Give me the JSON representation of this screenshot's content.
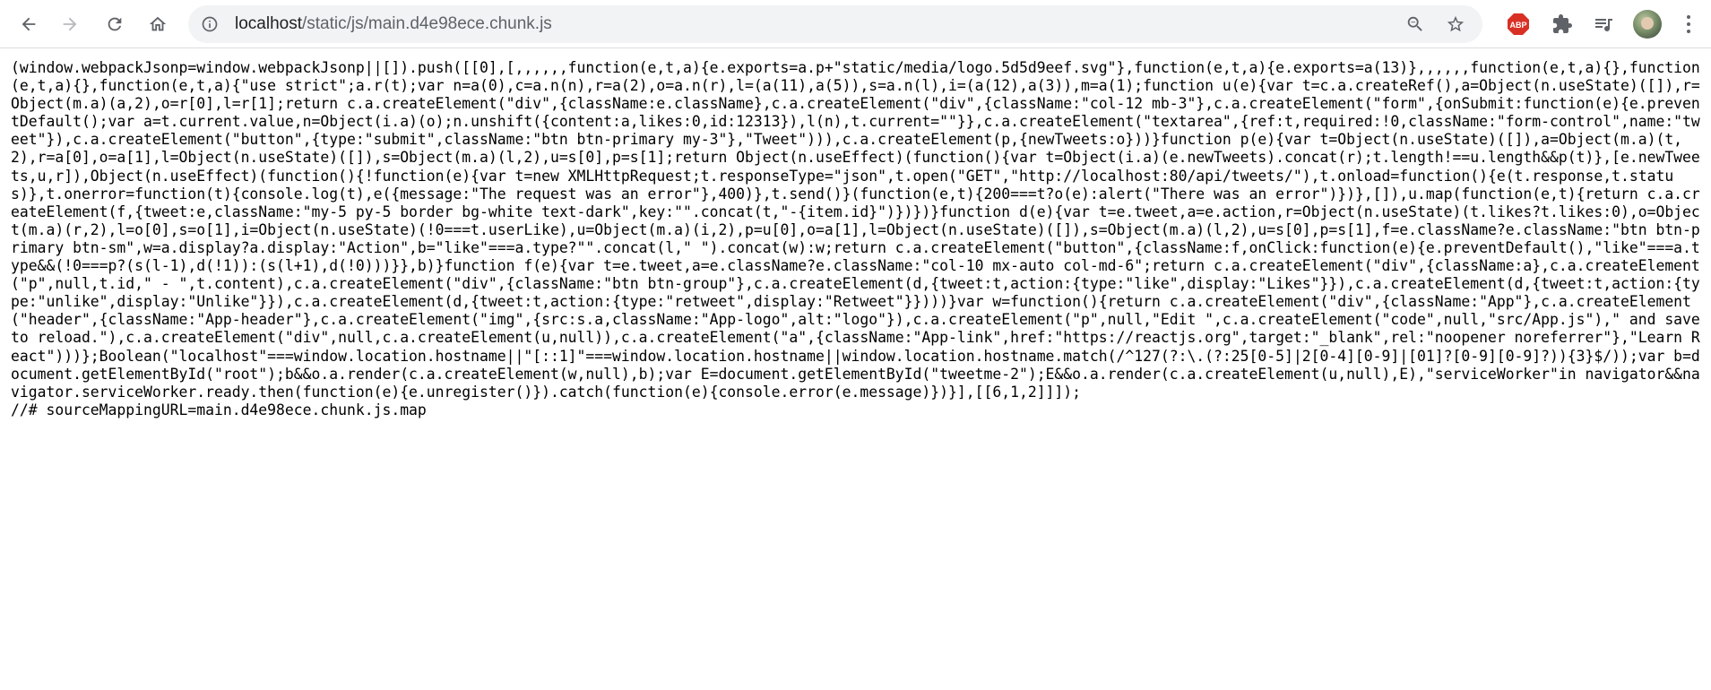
{
  "browser": {
    "url_host": "localhost",
    "url_path": "/static/js/main.d4e98ece.chunk.js",
    "icons": {
      "back": "back-arrow-icon",
      "forward": "forward-arrow-icon",
      "reload": "reload-icon",
      "home": "home-icon",
      "info": "info-icon",
      "zoom": "zoom-out-icon",
      "bookmark": "star-icon",
      "adblock": "abp-icon",
      "extensions": "puzzle-icon",
      "media": "media-queue-icon",
      "profile": "avatar-icon",
      "menu": "kebab-menu-icon"
    },
    "abp_label": "ABP",
    "colors": {
      "toolbar_bg": "#ffffff",
      "omnibox_bg": "#f1f3f4",
      "icon": "#5f6368",
      "abp_red": "#d93025"
    }
  },
  "page": {
    "code": "(window.webpackJsonp=window.webpackJsonp||[]).push([[0],[,,,,,,function(e,t,a){e.exports=a.p+\"static/media/logo.5d5d9eef.svg\"},function(e,t,a){e.exports=a(13)},,,,,,function(e,t,a){},function(e,t,a){},function(e,t,a){\"use strict\";a.r(t);var n=a(0),c=a.n(n),r=a(2),o=a.n(r),l=(a(11),a(5)),s=a.n(l),i=(a(12),a(3)),m=a(1);function u(e){var t=c.a.createRef(),a=Object(n.useState)([]),r=Object(m.a)(a,2),o=r[0],l=r[1];return c.a.createElement(\"div\",{className:e.className},c.a.createElement(\"div\",{className:\"col-12 mb-3\"},c.a.createElement(\"form\",{onSubmit:function(e){e.preventDefault();var a=t.current.value,n=Object(i.a)(o);n.unshift({content:a,likes:0,id:12313}),l(n),t.current=\"\"}},c.a.createElement(\"textarea\",{ref:t,required:!0,className:\"form-control\",name:\"tweet\"}),c.a.createElement(\"button\",{type:\"submit\",className:\"btn btn-primary my-3\"},\"Tweet\"))),c.a.createElement(p,{newTweets:o}))}function p(e){var t=Object(n.useState)([]),a=Object(m.a)(t,2),r=a[0],o=a[1],l=Object(n.useState)([]),s=Object(m.a)(l,2),u=s[0],p=s[1];return Object(n.useEffect)(function(){var t=Object(i.a)(e.newTweets).concat(r);t.length!==u.length&&p(t)},[e.newTweets,u,r]),Object(n.useEffect)(function(){!function(e){var t=new XMLHttpRequest;t.responseType=\"json\",t.open(\"GET\",\"http://localhost:80/api/tweets/\"),t.onload=function(){e(t.response,t.status)},t.onerror=function(t){console.log(t),e({message:\"The request was an error\"},400)},t.send()}(function(e,t){200===t?o(e):alert(\"There was an error\")})},[]),u.map(function(e,t){return c.a.createElement(f,{tweet:e,className:\"my-5 py-5 border bg-white text-dark\",key:\"\".concat(t,\"-{item.id}\")})})}function d(e){var t=e.tweet,a=e.action,r=Object(n.useState)(t.likes?t.likes:0),o=Object(m.a)(r,2),l=o[0],s=o[1],i=Object(n.useState)(!0===t.userLike),u=Object(m.a)(i,2),p=u[0],o=a[1],l=Object(n.useState)([]),s=Object(m.a)(l,2),u=s[0],p=s[1],f=e.className?e.className:\"btn btn-primary btn-sm\",w=a.display?a.display:\"Action\",b=\"like\"===a.type?\"\".concat(l,\" \").concat(w):w;return c.a.createElement(\"button\",{className:f,onClick:function(e){e.preventDefault(),\"like\"===a.type&&(!0===p?(s(l-1),d(!1)):(s(l+1),d(!0)))}},b)}function f(e){var t=e.tweet,a=e.className?e.className:\"col-10 mx-auto col-md-6\";return c.a.createElement(\"div\",{className:a},c.a.createElement(\"p\",null,t.id,\" - \",t.content),c.a.createElement(\"div\",{className:\"btn btn-group\"},c.a.createElement(d,{tweet:t,action:{type:\"like\",display:\"Likes\"}}),c.a.createElement(d,{tweet:t,action:{type:\"unlike\",display:\"Unlike\"}}),c.a.createElement(d,{tweet:t,action:{type:\"retweet\",display:\"Retweet\"}})))}var w=function(){return c.a.createElement(\"div\",{className:\"App\"},c.a.createElement(\"header\",{className:\"App-header\"},c.a.createElement(\"img\",{src:s.a,className:\"App-logo\",alt:\"logo\"}),c.a.createElement(\"p\",null,\"Edit \",c.a.createElement(\"code\",null,\"src/App.js\"),\" and save to reload.\"),c.a.createElement(\"div\",null,c.a.createElement(u,null)),c.a.createElement(\"a\",{className:\"App-link\",href:\"https://reactjs.org\",target:\"_blank\",rel:\"noopener noreferrer\"},\"Learn React\")))};Boolean(\"localhost\"===window.location.hostname||\"[::1]\"===window.location.hostname||window.location.hostname.match(/^127(?:\\.(?:25[0-5]|2[0-4][0-9]|[01]?[0-9][0-9]?)){3}$/));var b=document.getElementById(\"root\");b&&o.a.render(c.a.createElement(w,null),b);var E=document.getElementById(\"tweetme-2\");E&&o.a.render(c.a.createElement(u,null),E),\"serviceWorker\"in navigator&&navigator.serviceWorker.ready.then(function(e){e.unregister()}).catch(function(e){console.error(e.message)})}],[[6,1,2]]]);\n//# sourceMappingURL=main.d4e98ece.chunk.js.map"
  }
}
